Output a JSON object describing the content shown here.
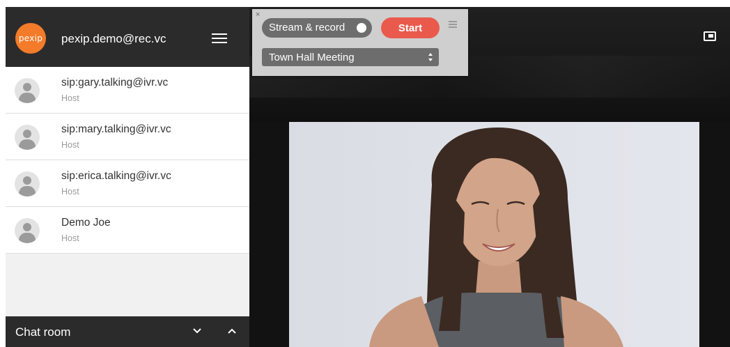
{
  "account": {
    "logo_text": "pexip",
    "email": "pexip.demo@rec.vc"
  },
  "participants": [
    {
      "name": "sip:gary.talking@ivr.vc",
      "role": "Host"
    },
    {
      "name": "sip:mary.talking@ivr.vc",
      "role": "Host"
    },
    {
      "name": "sip:erica.talking@ivr.vc",
      "role": "Host"
    },
    {
      "name": "Demo Joe",
      "role": "Host"
    }
  ],
  "chat": {
    "title": "Chat room"
  },
  "stream_panel": {
    "close": "×",
    "toggle_label": "Stream & record",
    "start_label": "Start",
    "selected_stream": "Town Hall Meeting"
  },
  "colors": {
    "brand": "#f37b2a",
    "start": "#ea5a4c",
    "header_bg": "#2b2b2b"
  },
  "icons": {
    "menu": "hamburger-icon",
    "pip": "picture-in-picture-icon",
    "chat_collapse": "chevron-down-icon",
    "chat_expand": "chevron-up-icon"
  }
}
